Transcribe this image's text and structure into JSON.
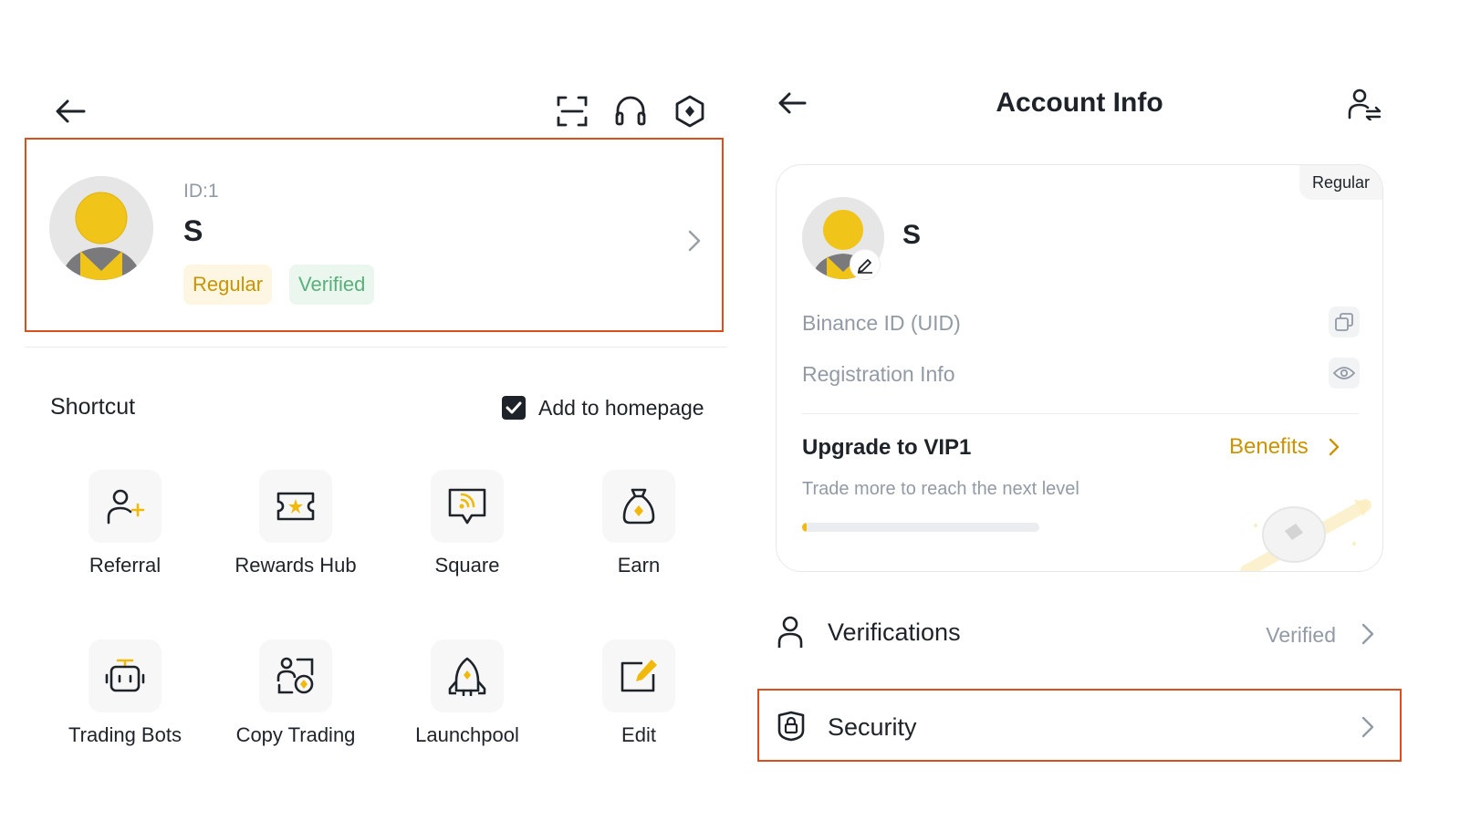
{
  "left": {
    "profile": {
      "id_text": "ID:1",
      "name": "S",
      "badges": {
        "regular": "Regular",
        "verified": "Verified"
      }
    },
    "shortcut": {
      "title": "Shortcut",
      "add_to_homepage": "Add to homepage",
      "add_checked": true,
      "items": [
        {
          "label": "Referral",
          "icon": "referral-icon"
        },
        {
          "label": "Rewards Hub",
          "icon": "rewards-hub-icon"
        },
        {
          "label": "Square",
          "icon": "square-icon"
        },
        {
          "label": "Earn",
          "icon": "earn-icon"
        },
        {
          "label": "Trading Bots",
          "icon": "trading-bots-icon"
        },
        {
          "label": "Copy Trading",
          "icon": "copy-trading-icon"
        },
        {
          "label": "Launchpool",
          "icon": "launchpool-icon"
        },
        {
          "label": "Edit",
          "icon": "edit-icon"
        }
      ]
    }
  },
  "right": {
    "title": "Account Info",
    "card": {
      "badge": "Regular",
      "name": "S",
      "uid_label": "Binance ID (UID)",
      "registration_label": "Registration Info",
      "upgrade_title": "Upgrade to VIP1",
      "benefits": "Benefits",
      "upgrade_sub": "Trade more to reach the next level",
      "progress": 0.02
    },
    "rows": {
      "verifications": {
        "label": "Verifications",
        "status": "Verified"
      },
      "security": {
        "label": "Security"
      }
    }
  },
  "colors": {
    "accent_yellow": "#F0B90B",
    "benefits_gold": "#C99400",
    "highlight_border": "#D9501E",
    "verified_green": "#58B07A"
  }
}
